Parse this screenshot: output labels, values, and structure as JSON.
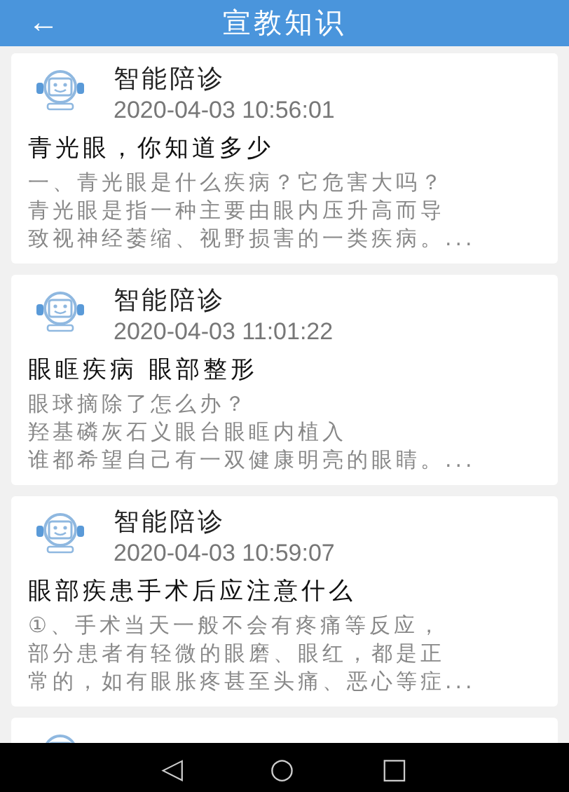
{
  "header": {
    "back": "←",
    "title": "宣教知识"
  },
  "articles": [
    {
      "author": "智能陪诊",
      "time": "2020-04-03 10:56:01",
      "title": "青光眼，你知道多少",
      "lines": [
        "一、青光眼是什么疾病？它危害大吗？",
        "青光眼是指一种主要由眼内压升高而导",
        "致视神经萎缩、视野损害的一类疾病。..."
      ]
    },
    {
      "author": "智能陪诊",
      "time": "2020-04-03 11:01:22",
      "title": "眼眶疾病  眼部整形",
      "lines": [
        "眼球摘除了怎么办？",
        "羟基磷灰石义眼台眼眶内植入",
        "谁都希望自己有一双健康明亮的眼睛。..."
      ]
    },
    {
      "author": "智能陪诊",
      "time": "2020-04-03 10:59:07",
      "title": "眼部疾患手术后应注意什么",
      "lines": [
        "①、手术当天一般不会有疼痛等反应，",
        "部分患者有轻微的眼磨、眼红，都是正",
        "常的，如有眼胀疼甚至头痛、恶心等症..."
      ]
    },
    {
      "partial": true
    }
  ],
  "nav": [
    "◁",
    "○",
    "□"
  ]
}
